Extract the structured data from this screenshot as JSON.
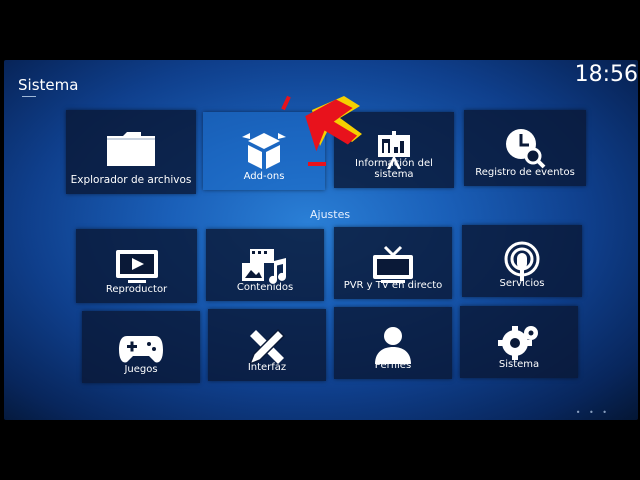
{
  "window": {
    "title": "Sistema",
    "clock": "18:56"
  },
  "top_row": [
    {
      "label": "Explorador de archivos",
      "icon": "folder-icon"
    },
    {
      "label": "Add-ons",
      "icon": "box-icon",
      "focused": true
    },
    {
      "label": "Información del sistema",
      "icon": "presentation-icon"
    },
    {
      "label": "Registro de eventos",
      "icon": "clock-search-icon"
    }
  ],
  "section": {
    "label": "Ajustes"
  },
  "settings_row_1": [
    {
      "label": "Reproductor",
      "icon": "monitor-play-icon"
    },
    {
      "label": "Contenidos",
      "icon": "media-icon"
    },
    {
      "label": "PVR y TV en directo",
      "icon": "tv-icon"
    },
    {
      "label": "Servicios",
      "icon": "podcast-icon"
    }
  ],
  "settings_row_2": [
    {
      "label": "Juegos",
      "icon": "gamepad-icon"
    },
    {
      "label": "Interfaz",
      "icon": "pencil-ruler-icon"
    },
    {
      "label": "Perfiles",
      "icon": "person-icon"
    },
    {
      "label": "Sistema",
      "icon": "gears-icon"
    }
  ],
  "colors": {
    "background_center": "#2a7fd6",
    "background_edge": "#041634",
    "tile": "#0a1937",
    "annotation_arrow": "#e8121c",
    "annotation_arrow_shadow": "#f5d000"
  }
}
